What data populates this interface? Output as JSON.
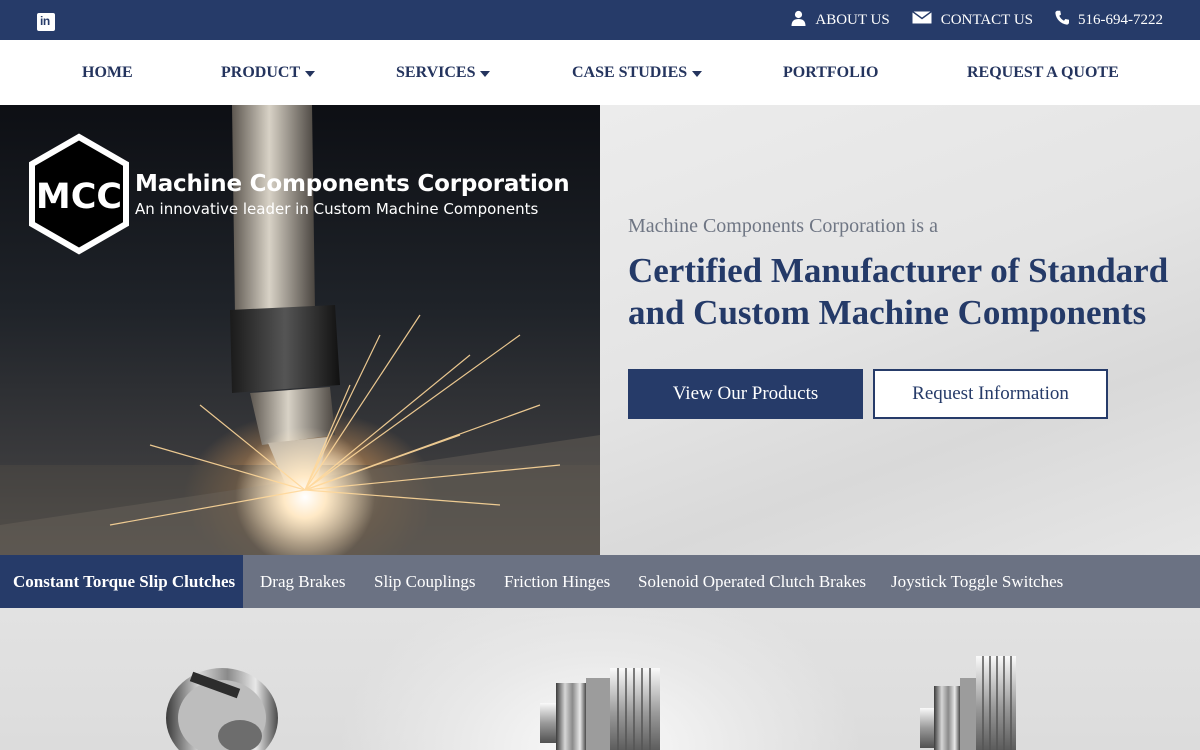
{
  "topbar": {
    "social_icon": "linkedin-icon",
    "linkedin_label": "in",
    "links": [
      {
        "label": "ABOUT US",
        "icon": "user-icon"
      },
      {
        "label": "CONTACT US",
        "icon": "envelope-icon"
      },
      {
        "label": "516-694-7222",
        "icon": "phone-icon"
      }
    ]
  },
  "nav": {
    "items": [
      {
        "label": "HOME",
        "dropdown": false
      },
      {
        "label": "PRODUCT",
        "dropdown": true
      },
      {
        "label": "SERVICES",
        "dropdown": true
      },
      {
        "label": "CASE STUDIES",
        "dropdown": true
      },
      {
        "label": "PORTFOLIO",
        "dropdown": false
      },
      {
        "label": "REQUEST A QUOTE",
        "dropdown": false
      }
    ]
  },
  "hero": {
    "logo_mark": "MCC",
    "company_name": "Machine Components Corporation",
    "tagline": "An innovative leader in Custom Machine Components",
    "intro": "Machine Components Corporation is a",
    "headline": "Certified Manufacturer of Standard and Custom Machine Components",
    "primary_button": "View Our Products",
    "secondary_button": "Request Information"
  },
  "product_tabs": {
    "active": "Constant Torque Slip Clutches",
    "items": [
      "Constant Torque Slip Clutches",
      "Drag Brakes",
      "Slip Couplings",
      "Friction Hinges",
      "Solenoid Operated Clutch Brakes",
      "Joystick Toggle Switches"
    ]
  },
  "colors": {
    "brand_navy": "#263b69",
    "tab_bar": "#6b7283",
    "intro_gray": "#6f7684"
  }
}
